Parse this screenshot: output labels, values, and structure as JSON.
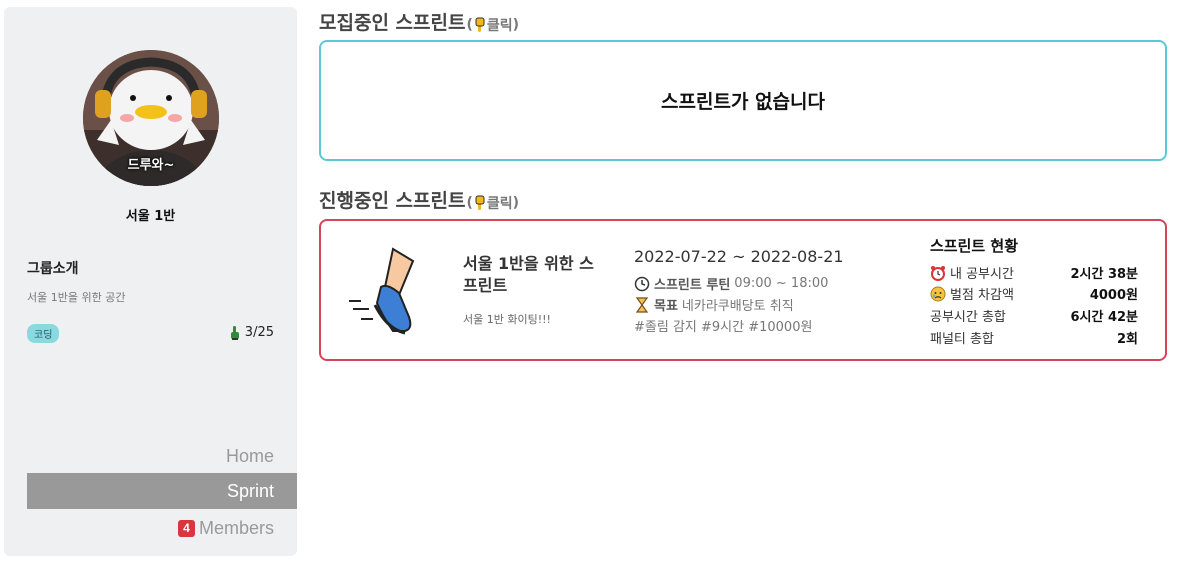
{
  "sidebar": {
    "avatar_caption": "드루와~",
    "group_name": "서울 1반",
    "intro_title": "그룹소개",
    "intro_desc": "서울 1반을 위한 공간",
    "tag": "코딩",
    "member_count": "3/25",
    "nav": {
      "home": "Home",
      "sprint": "Sprint",
      "members_badge": "4",
      "members": "Members"
    }
  },
  "recruiting": {
    "title": "모집중인 스프린트",
    "click": "클릭",
    "empty_text": "스프린트가 없습니다"
  },
  "ongoing": {
    "title": "진행중인 스프린트",
    "click": "클릭",
    "sprint": {
      "name": "서울 1반을 위한 스프린트",
      "subtitle": "서울 1반 화이팅!!!",
      "dates": "2022-07-22 ~ 2022-08-21",
      "routine_label": "스프린트 루틴",
      "routine_time": "09:00 ~ 18:00",
      "goal_label": "목표",
      "goal_text": "네카라쿠배당토 취직",
      "tags": "#졸림 감지 #9시간 #10000원"
    },
    "status": {
      "title": "스프린트 현황",
      "my_study_label": "내 공부시간",
      "my_study_value": "2시간 38분",
      "penalty_amount_label": "벌점 차감액",
      "penalty_amount_value": "4000원",
      "total_study_label": "공부시간 총합",
      "total_study_value": "6시간 42분",
      "total_penalty_label": "패널티 총합",
      "total_penalty_value": "2회"
    }
  },
  "colors": {
    "recruit_border": "#5cc8d4",
    "ongoing_border": "#d4455a",
    "active_nav": "#999999",
    "badge": "#d9363e",
    "tag_bg": "#8ad9e0"
  }
}
